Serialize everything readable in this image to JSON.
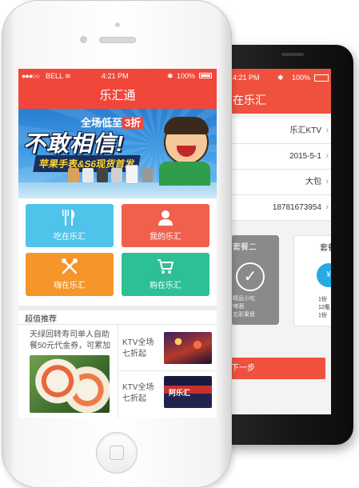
{
  "back_screen": {
    "status_time": "4:21 PM",
    "header_title": "在乐汇",
    "rows": [
      {
        "value": "乐汇KTV"
      },
      {
        "value": "2015-5-1"
      },
      {
        "value": "大包"
      },
      {
        "value": "18781673954"
      }
    ],
    "package_left": "套餐二",
    "package_right": "套餐",
    "package_right_items": [
      "1份",
      "12瓶",
      "1份"
    ],
    "package_left_items": [
      "精品小吃",
      "啤酒",
      "五彩果盘"
    ],
    "next_button": "下一步"
  },
  "front_screen": {
    "status": {
      "carrier": "BELL",
      "time": "4:21 PM",
      "battery": "100%"
    },
    "header_title": "乐汇通",
    "banner": {
      "top_text": "全场低至",
      "top_highlight": "3折",
      "main_text": "不敢相信!",
      "sub_text": "苹果手表&S6现货首发"
    },
    "tiles": [
      {
        "label": "吃在乐汇",
        "color": "#4fc3ea",
        "icon": "fork-knife-icon"
      },
      {
        "label": "我的乐汇",
        "color": "#f0604d",
        "icon": "user-icon"
      },
      {
        "label": "嗨在乐汇",
        "color": "#f5952a",
        "icon": "mic-icon"
      },
      {
        "label": "购在乐汇",
        "color": "#2dbf96",
        "icon": "cart-icon"
      }
    ],
    "section_title": "超值推荐",
    "deal_text": "天绿回转寿司单人自助餐50元代金券，可累加",
    "ktv_items": [
      {
        "text": "KTV全场七折起"
      },
      {
        "text": "KTV全场七折起",
        "sign": "阿乐汇"
      }
    ]
  }
}
